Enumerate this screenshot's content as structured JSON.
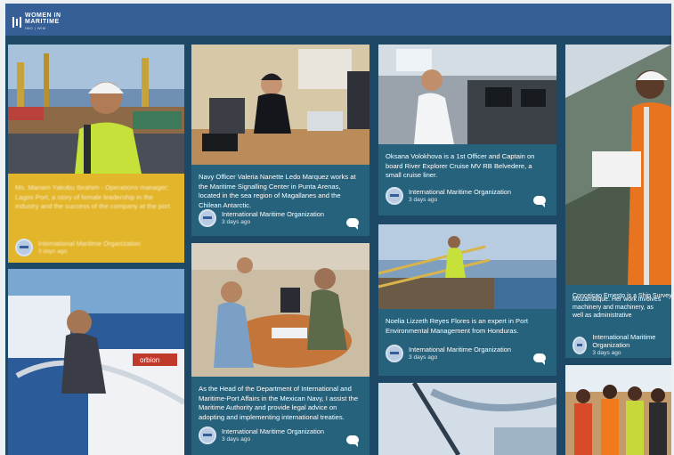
{
  "header": {
    "logo_line1": "WOMEN IN",
    "logo_line2": "MARITIME",
    "logo_line3": "IMO | WIM"
  },
  "colors": {
    "header": "#355f96",
    "card_dark": "#27627c",
    "card_yellow": "#e3b52a",
    "board": "#1e4966"
  },
  "posts": [
    {
      "id": "p1",
      "caption": "Navy Officer Valeria Nanette Ledo Marquez works at the Maritime Signalling Center in Punta Arenas, located in the sea region of Magallanes and the Chilean Antarctic.",
      "org": "International Maritime Organization",
      "time": "3 days ago"
    },
    {
      "id": "p2",
      "caption": "Oksana Volokhova is a 1st Officer and Captain on board River Explorer Cruise MV RB Belvedere, a small cruise liner.",
      "org": "International Maritime Organization",
      "time": "3 days ago"
    },
    {
      "id": "p3",
      "caption": "Noelia Lizzeth Reyes Flores is an expert in Port Environmental Management from Honduras.",
      "org": "International Maritime Organization",
      "time": "3 days ago"
    },
    {
      "id": "p4",
      "caption": "As the Head of the Department of International and Maritime-Port Affairs in the Mexican Navy, I assist the Maritime Authority and provide legal advice on adopting and implementing international treaties.",
      "org": "International Maritime Organization",
      "time": "3 days ago"
    },
    {
      "id": "p5",
      "caption": "Mozambique. Her work involves machinery and machinery, as well as administrative",
      "caption_top": "Conceicao Ernesto is a Ship Surveyor",
      "org": "International Maritime Organization",
      "time": "3 days ago"
    }
  ],
  "yellow_card": {
    "caption": "Ms. Mariam Yakubu Ibrahim - Operations manager; Lagos Port, a story of female leadership in the industry and the success of the company at the port.",
    "org": "International Maritime Organization",
    "time": "3 days ago"
  }
}
